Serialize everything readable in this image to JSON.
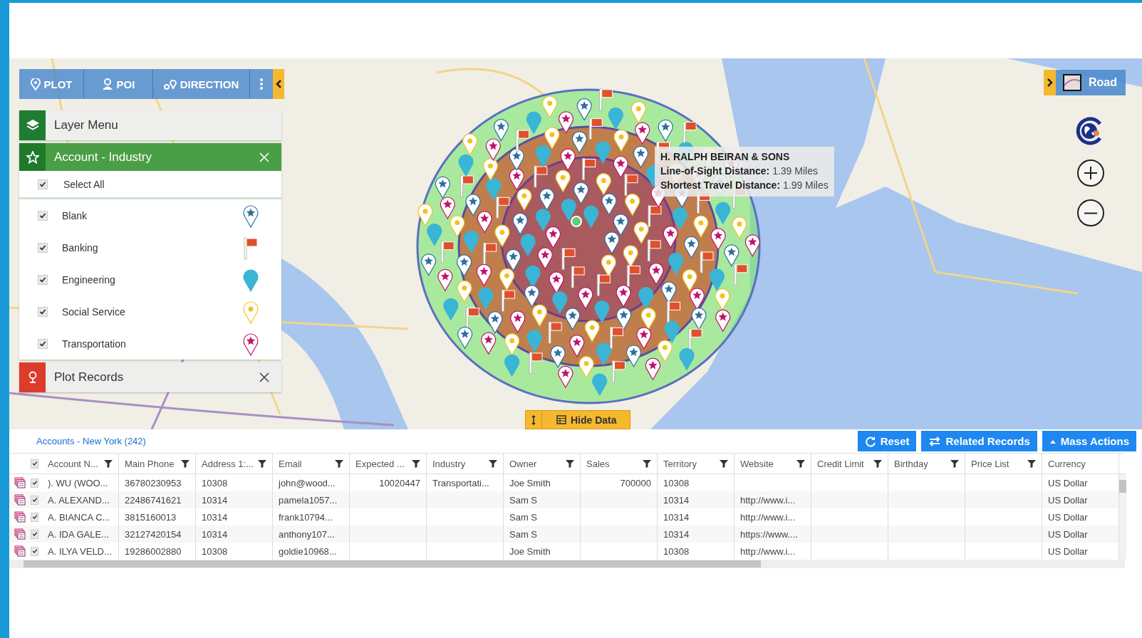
{
  "toolbar": {
    "buttons": [
      {
        "label": "PLOT",
        "kind": "plot"
      },
      {
        "label": "POI",
        "kind": "poi"
      },
      {
        "label": "DIRECTION",
        "kind": "direction"
      }
    ]
  },
  "layer_menu": {
    "title": "Layer Menu"
  },
  "layer": {
    "title": "Account - Industry",
    "select_all": {
      "label": "Select All",
      "checked": true
    },
    "items": [
      {
        "label": "Blank",
        "checked": true,
        "kind": "star-pin",
        "color": "#2f6f9f"
      },
      {
        "label": "Banking",
        "checked": true,
        "kind": "flag",
        "color": "#e0502c"
      },
      {
        "label": "Engineering",
        "checked": true,
        "kind": "pin",
        "color": "#3ab5d6"
      },
      {
        "label": "Social Service",
        "checked": true,
        "kind": "dot-pin",
        "color": "#f2c21e"
      },
      {
        "label": "Transportation",
        "checked": true,
        "kind": "star-pin",
        "color": "#c0136a"
      }
    ]
  },
  "plot_records": {
    "title": "Plot Records"
  },
  "tooltip": {
    "title": "H. RALPH BEIRAN & SONS",
    "lines": [
      {
        "label": "Line-of-Sight Distance:",
        "value": "1.39 Miles"
      },
      {
        "label": "Shortest Travel Distance:",
        "value": "1.99 Miles"
      }
    ]
  },
  "map_type": {
    "label": "Road"
  },
  "hide_data": {
    "label": "Hide Data"
  },
  "grid": {
    "title": "Accounts - New York (242)",
    "header_checked": true,
    "buttons": [
      {
        "label": "Reset",
        "kind": "reset"
      },
      {
        "label": "Related Records",
        "kind": "related"
      },
      {
        "label": "Mass Actions",
        "kind": "mass"
      }
    ],
    "columns": [
      {
        "label": "Account N...",
        "filter": true,
        "kind": "text"
      },
      {
        "label": "Main Phone",
        "filter": true,
        "kind": "text"
      },
      {
        "label": "Address 1:...",
        "filter": true,
        "kind": "text"
      },
      {
        "label": "Email",
        "filter": true,
        "kind": "text"
      },
      {
        "label": "Expected ...",
        "filter": true,
        "kind": "number"
      },
      {
        "label": "Industry",
        "filter": true,
        "kind": "text"
      },
      {
        "label": "Owner",
        "filter": true,
        "kind": "text"
      },
      {
        "label": "Sales",
        "filter": true,
        "kind": "number"
      },
      {
        "label": "Territory",
        "filter": true,
        "kind": "text"
      },
      {
        "label": "Website",
        "filter": true,
        "kind": "text"
      },
      {
        "label": "Credit Limit",
        "filter": true,
        "kind": "text"
      },
      {
        "label": "Birthday",
        "filter": true,
        "kind": "text"
      },
      {
        "label": "Price List",
        "filter": true,
        "kind": "text"
      },
      {
        "label": "Currency",
        "filter": false,
        "kind": "text"
      }
    ],
    "rows": [
      {
        "checked": true,
        "cells": [
          "). WU (WOO...",
          "36780230953",
          "10308",
          "john@wood...",
          "10020447",
          "Transportati...",
          "Joe Smith",
          "700000",
          "10308",
          null,
          null,
          null,
          null,
          "US Dollar"
        ]
      },
      {
        "checked": true,
        "cells": [
          "A. ALEXAND...",
          "22486741621",
          "10314",
          "pamela1057...",
          null,
          null,
          "Sam S",
          null,
          "10314",
          "http://www.i...",
          null,
          null,
          null,
          "US Dollar"
        ]
      },
      {
        "checked": true,
        "cells": [
          "A. BIANCA C...",
          "3815160013",
          "10314",
          "frank10794...",
          null,
          null,
          "Sam S",
          null,
          "10314",
          "http://www.i...",
          null,
          null,
          null,
          "US Dollar"
        ]
      },
      {
        "checked": true,
        "cells": [
          "A. IDA GALE...",
          "32127420154",
          "10314",
          "anthony107...",
          null,
          null,
          "Sam S",
          null,
          "10314",
          "https://www....",
          null,
          null,
          null,
          "US Dollar"
        ]
      },
      {
        "checked": true,
        "cells": [
          "A. ILYA VELD...",
          "19286002880",
          "10308",
          "goldie10968...",
          null,
          null,
          "Joe Smith",
          null,
          "10308",
          "http://www.i...",
          null,
          null,
          null,
          "US Dollar"
        ]
      }
    ]
  }
}
